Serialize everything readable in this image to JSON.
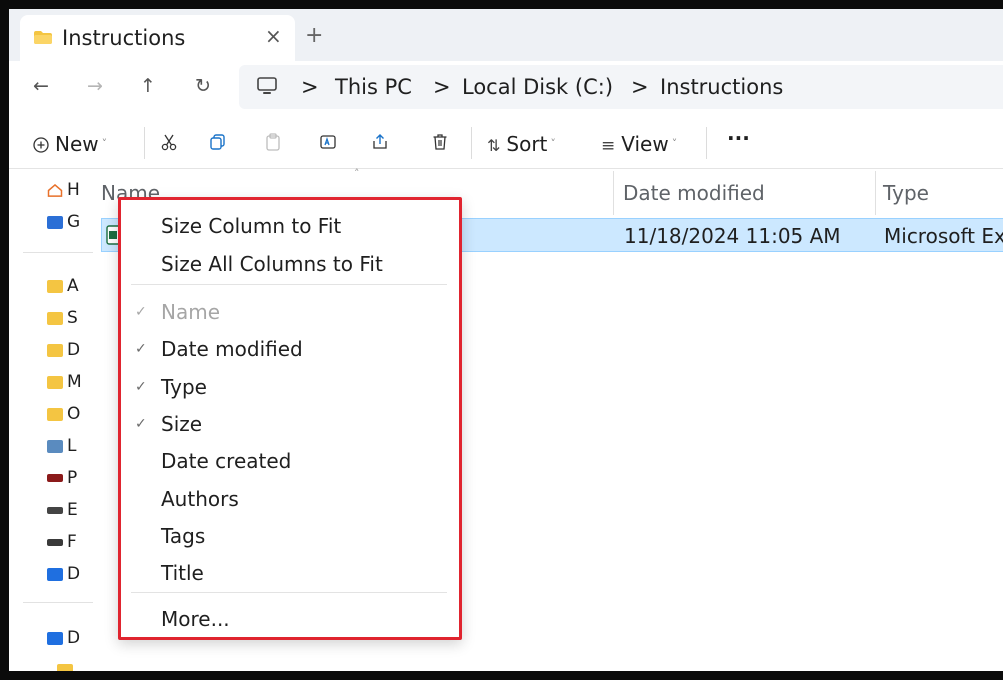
{
  "window": {
    "tab_title": "Instructions",
    "tab_close": "×",
    "new_tab": "+"
  },
  "address": {
    "back": "←",
    "forward": "→",
    "up": "↑",
    "refresh": "↻",
    "separator": ">",
    "crumbs": [
      "This PC",
      "Local Disk (C:)",
      "Instructions"
    ]
  },
  "toolbar": {
    "new_label": "New",
    "sort_label": "Sort",
    "view_label": "View",
    "more_label": "···",
    "caret": "˅",
    "sort_glyph": "⇅",
    "view_glyph": "≡"
  },
  "sidebar": {
    "items": [
      "H",
      "G",
      "A",
      "S",
      "D",
      "M",
      "O",
      "L",
      "P",
      "E",
      "F",
      "D",
      "D",
      ""
    ]
  },
  "file_list": {
    "columns": {
      "name": "Name",
      "date_modified": "Date modified",
      "type": "Type"
    },
    "sort_caret": "˄",
    "rows": [
      {
        "name": "",
        "date_modified": "11/18/2024 11:05 AM",
        "type": "Microsoft Ex"
      }
    ]
  },
  "context_menu": {
    "check_glyph": "✓",
    "items": [
      {
        "label": "Size Column to Fit",
        "checked": false,
        "disabled": false
      },
      {
        "label": "Size All Columns to Fit",
        "checked": false,
        "disabled": false
      },
      {
        "label": "Name",
        "checked": true,
        "disabled": true
      },
      {
        "label": "Date modified",
        "checked": true,
        "disabled": false
      },
      {
        "label": "Type",
        "checked": true,
        "disabled": false
      },
      {
        "label": "Size",
        "checked": true,
        "disabled": false
      },
      {
        "label": "Date created",
        "checked": false,
        "disabled": false
      },
      {
        "label": "Authors",
        "checked": false,
        "disabled": false
      },
      {
        "label": "Tags",
        "checked": false,
        "disabled": false
      },
      {
        "label": "Title",
        "checked": false,
        "disabled": false
      },
      {
        "label": "More...",
        "checked": false,
        "disabled": false
      }
    ]
  },
  "colors": {
    "menu_highlight_border": "#e0242f",
    "selection_fill": "#cce8ff",
    "folder_yellow": "#f4c542"
  }
}
